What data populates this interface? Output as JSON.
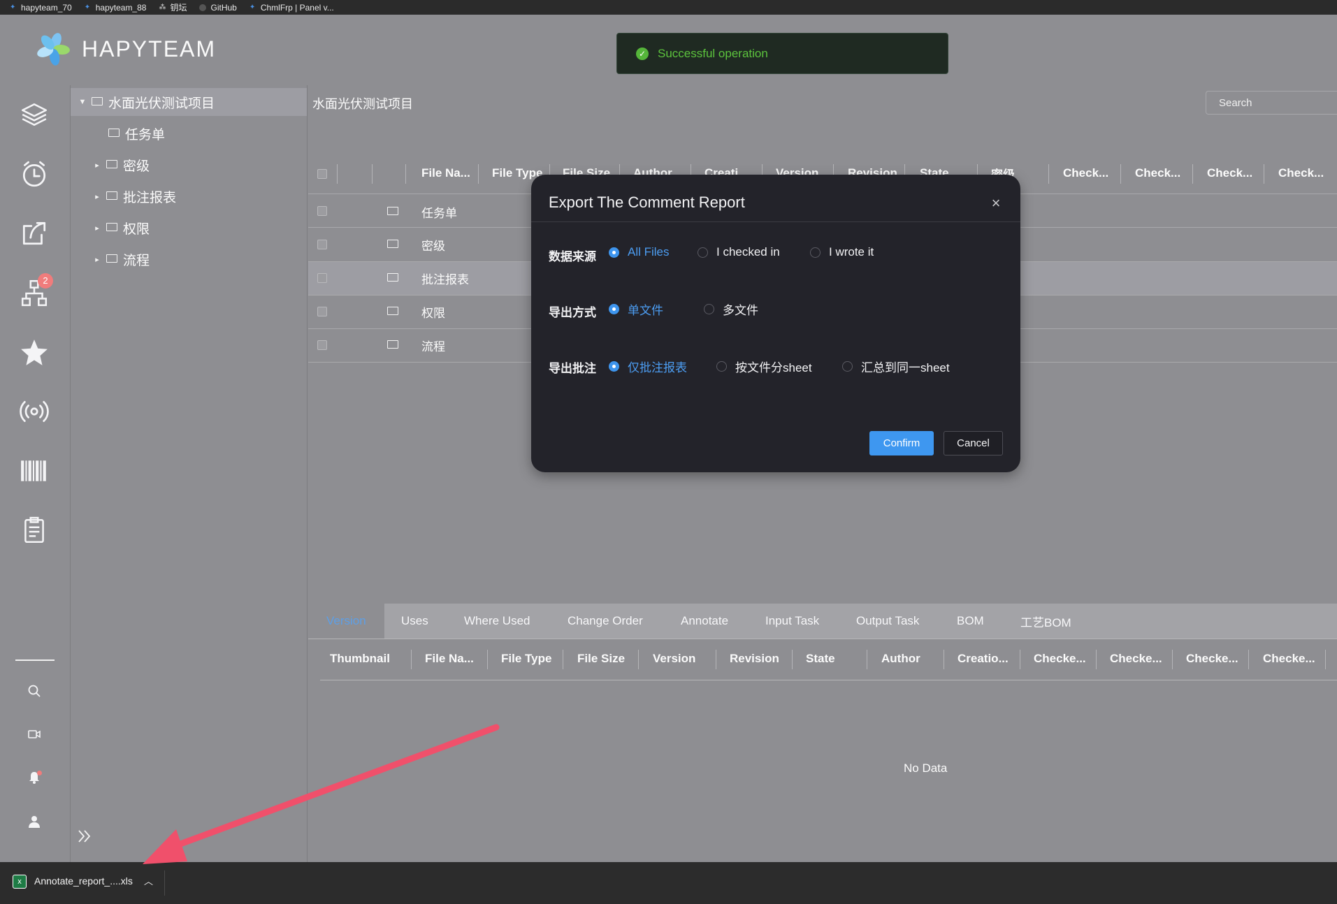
{
  "bookmarks": [
    "hapyteam_70",
    "hapyteam_88",
    "钥坛",
    "GitHub",
    "ChmlFrp | Panel v..."
  ],
  "brand": "HAPYTEAM",
  "toast": {
    "message": "Successful operation",
    "icon": "check-circle-icon",
    "color": "#55b53a"
  },
  "sidebar_icons": [
    "layers-icon",
    "alarm-clock-icon",
    "share-icon",
    "hierarchy-icon",
    "star-icon",
    "broadcast-icon",
    "barcode-icon",
    "clipboard-icon",
    "search-icon",
    "video-icon",
    "bell-icon",
    "user-icon"
  ],
  "notification_badge": "2",
  "tree": {
    "root": "水面光伏测试项目",
    "children": [
      "任务单",
      "密级",
      "批注报表",
      "权限",
      "流程"
    ]
  },
  "main": {
    "title": "水面光伏测试项目",
    "search_placeholder": "Search",
    "columns": [
      "File Na...",
      "File Type",
      "File Size",
      "Author",
      "Creati...",
      "Version",
      "Revision",
      "State",
      "密级",
      "Check...",
      "Check...",
      "Check...",
      "Check..."
    ],
    "rows": [
      "任务单",
      "密级",
      "批注报表",
      "权限",
      "流程"
    ],
    "selected_row": 2
  },
  "bottom": {
    "tabs": [
      "Version",
      "Uses",
      "Where Used",
      "Change Order",
      "Annotate",
      "Input Task",
      "Output Task",
      "BOM",
      "工艺BOM"
    ],
    "active_tab": "Version",
    "columns": [
      "Thumbnail",
      "File Na...",
      "File Type",
      "File Size",
      "Version",
      "Revision",
      "State",
      "Author",
      "Creatio...",
      "Checke...",
      "Checke...",
      "Checke...",
      "Checke..."
    ],
    "empty_text": "No Data"
  },
  "modal": {
    "title": "Export The Comment Report",
    "fields": [
      {
        "label": "数据来源",
        "options": [
          "All Files",
          "I checked in",
          "I wrote it"
        ],
        "selected": "All Files"
      },
      {
        "label": "导出方式",
        "options": [
          "单文件",
          "多文件"
        ],
        "selected": "单文件"
      },
      {
        "label": "导出批注",
        "options": [
          "仅批注报表",
          "按文件分sheet",
          "汇总到同一sheet"
        ],
        "selected": "仅批注报表"
      }
    ],
    "confirm": "Confirm",
    "cancel": "Cancel",
    "accent": "#3e97f0"
  },
  "download": {
    "filename": "Annotate_report_....xls"
  }
}
